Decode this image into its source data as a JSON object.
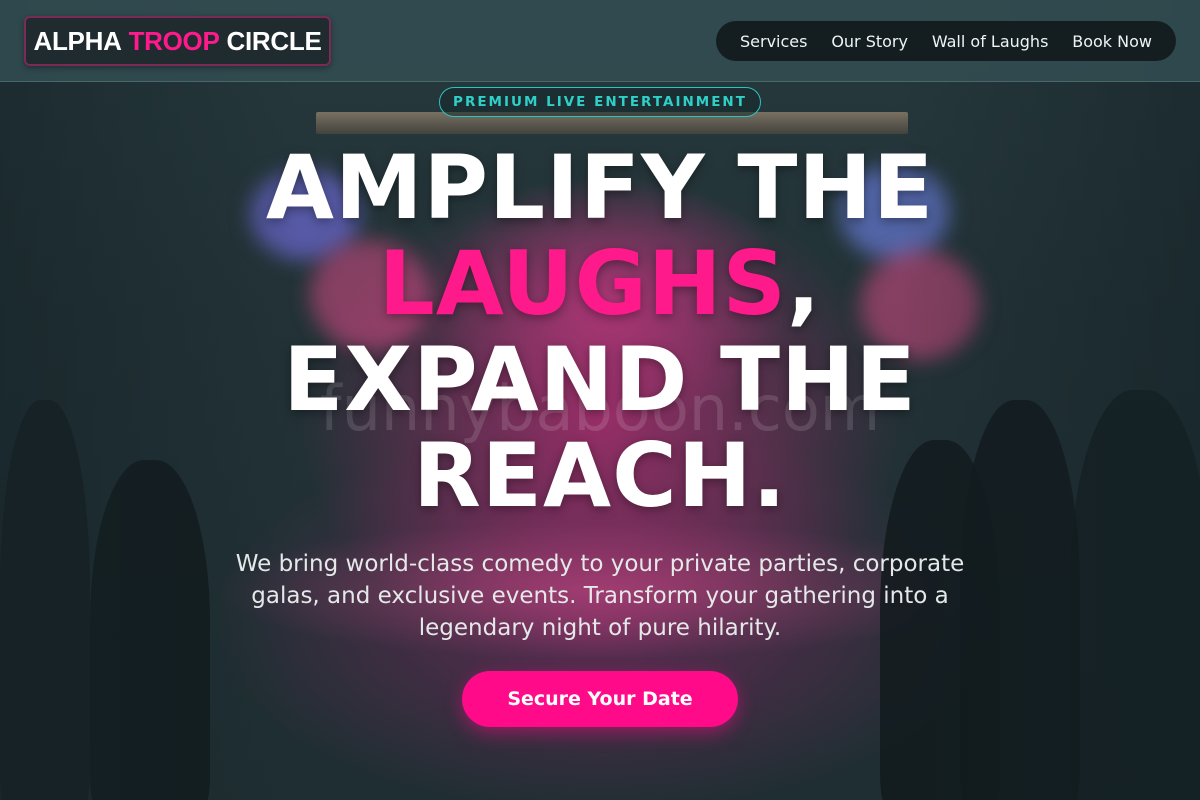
{
  "brand": {
    "logo_part1": "ALPHA",
    "logo_part2": "TROOP",
    "logo_part3": "CIRCLE",
    "accent_color": "#ff1a8c"
  },
  "nav": {
    "items": [
      {
        "label": "Services"
      },
      {
        "label": "Our Story"
      },
      {
        "label": "Wall of Laughs"
      },
      {
        "label": "Book Now"
      }
    ]
  },
  "hero": {
    "badge": "PREMIUM LIVE ENTERTAINMENT",
    "headline_line1": "AMPLIFY THE",
    "headline_highlight": "LAUGHS",
    "headline_comma": ",",
    "headline_line3": "EXPAND THE",
    "headline_line4": "REACH.",
    "watermark": "funnybaboon.com",
    "subtext": "We bring world-class comedy to your private parties, corporate galas, and exclusive events. Transform your gathering into a legendary night of pure hilarity.",
    "cta_label": "Secure Your Date",
    "badge_color": "#2fd0c8",
    "cta_color": "#ff0a88"
  }
}
